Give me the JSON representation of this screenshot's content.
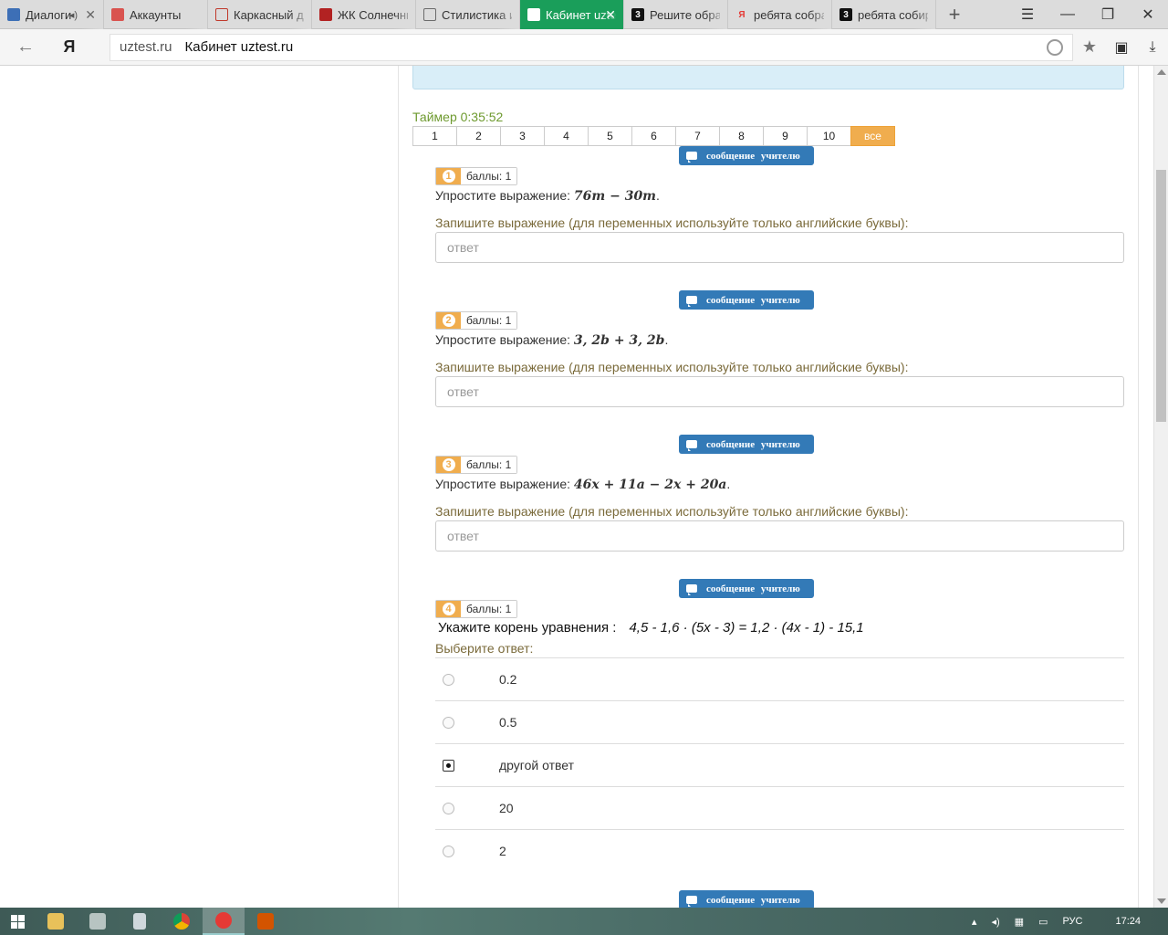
{
  "browser": {
    "tabs": [
      {
        "title": "Диалоги",
        "favicon_color": "#3d6fb6",
        "close": "✕",
        "has_audio": true
      },
      {
        "title": "Аккаунты",
        "favicon_color": "#d9534f"
      },
      {
        "title": "Каркасный дом",
        "favicon_color": "#c0392b"
      },
      {
        "title": "ЖК Солнечный",
        "favicon_color": "#b22222"
      },
      {
        "title": "Стилистика и",
        "favicon_color": "#6b6b6b"
      },
      {
        "title": "Кабинет uztest",
        "favicon_color": "#ffffff",
        "active": true,
        "close": "✕"
      },
      {
        "title": "Решите обра",
        "favicon_color": "#111111",
        "favicon_text": "3"
      },
      {
        "title": "ребята собра",
        "favicon_color": "#e53935",
        "favicon_text": "Я"
      },
      {
        "title": "ребята собир",
        "favicon_color": "#111111",
        "favicon_text": "3"
      }
    ],
    "new_tab": "+",
    "window_controls": {
      "menu": "☰",
      "minimize": "—",
      "restore": "❐",
      "close": "✕"
    },
    "address": {
      "back": "←",
      "yandex": "Я",
      "domain": "uztest.ru",
      "page_title": "Кабинет uztest.ru"
    }
  },
  "test": {
    "timer": "Таймер 0:35:52",
    "pages": [
      "1",
      "2",
      "3",
      "4",
      "5",
      "6",
      "7",
      "8",
      "9",
      "10",
      "все"
    ],
    "message_button": "сообщение учителю",
    "questions": [
      {
        "number": "1",
        "score": "баллы: 1",
        "prompt": "Упростите выражение: ",
        "math": "76m − 30m",
        "suffix": ".",
        "hint": "Запишите выражение (для переменных используйте только английские буквы):",
        "placeholder": "ответ"
      },
      {
        "number": "2",
        "score": "баллы: 1",
        "prompt": "Упростите выражение: ",
        "math": "3, 2b + 3, 2b",
        "suffix": ".",
        "hint": "Запишите выражение (для переменных используйте только английские буквы):",
        "placeholder": "ответ"
      },
      {
        "number": "3",
        "score": "баллы: 1",
        "prompt": "Упростите выражение: ",
        "math": "46x + 11a − 2x + 20a",
        "suffix": ".",
        "hint": "Запишите выражение (для переменных используйте только английские буквы):",
        "placeholder": "ответ"
      },
      {
        "number": "4",
        "score": "баллы: 1",
        "prompt": "Укажите корень уравнения :",
        "equation": "4,5 - 1,6 · (5x - 3) = 1,2 · (4x - 1) - 15,1",
        "hint": "Выберите ответ:",
        "options": [
          "0.2",
          "0.5",
          "другой ответ",
          "20",
          "2"
        ],
        "selected_option": "другой ответ"
      }
    ]
  },
  "taskbar": {
    "tray_lang": "РУС",
    "clock": "17:24",
    "tray_arrow": "▴"
  }
}
